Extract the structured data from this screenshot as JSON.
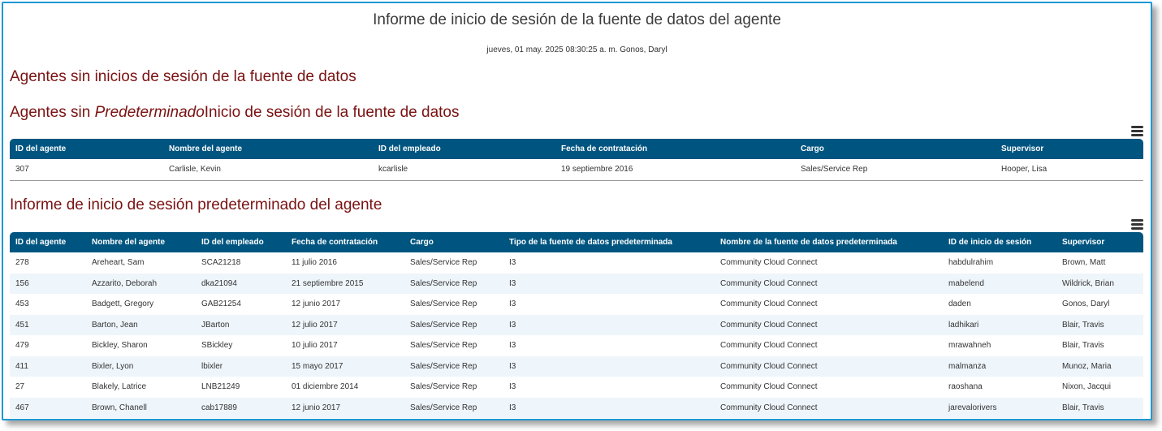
{
  "report": {
    "title": "Informe de inicio de sesión de la fuente de datos del agente",
    "meta": "jueves, 01 may. 2025 08:30:25 a. m. Gonos, Daryl"
  },
  "sections": {
    "no_logins": "Agentes sin inicios de sesión de la fuente de datos",
    "no_default_prefix": "Agentes sin ",
    "no_default_em": "Predeterminado",
    "no_default_suffix": "Inicio de sesión de la fuente de datos",
    "default_report": "Informe de inicio de sesión predeterminado del agente"
  },
  "icons": {
    "menu": "hamburger-menu-icon"
  },
  "colors": {
    "header_bg": "#005580",
    "heading": "#7a1212",
    "frame": "#1f97d4"
  },
  "table1": {
    "columns": [
      "ID del agente",
      "Nombre del agente",
      "ID del empleado",
      "Fecha de contratación",
      "Cargo",
      "Supervisor"
    ],
    "rows": [
      [
        "307",
        "Carlisle, Kevin",
        "kcarlisle",
        "19 septiembre 2016",
        "Sales/Service Rep",
        "Hooper, Lisa"
      ]
    ]
  },
  "table2": {
    "columns": [
      "ID del agente",
      "Nombre del agente",
      "ID del empleado",
      "Fecha de contratación",
      "Cargo",
      "Tipo de la fuente de datos predeterminada",
      "Nombre de la fuente de datos predeterminada",
      "ID de inicio de sesión",
      "Supervisor"
    ],
    "rows": [
      [
        "278",
        "Areheart, Sam",
        "SCA21218",
        "11 julio 2016",
        "Sales/Service Rep",
        "I3",
        "Community Cloud Connect",
        "habdulrahim",
        "Brown, Matt"
      ],
      [
        "156",
        "Azzarito, Deborah",
        "dka21094",
        "21 septiembre 2015",
        "Sales/Service Rep",
        "I3",
        "Community Cloud Connect",
        "mabelend",
        "Wildrick, Brian"
      ],
      [
        "453",
        "Badgett, Gregory",
        "GAB21254",
        "12 junio 2017",
        "Sales/Service Rep",
        "I3",
        "Community Cloud Connect",
        "daden",
        "Gonos, Daryl"
      ],
      [
        "451",
        "Barton, Jean",
        "JBarton",
        "12 julio 2017",
        "Sales/Service Rep",
        "I3",
        "Community Cloud Connect",
        "ladhikari",
        "Blair, Travis"
      ],
      [
        "479",
        "Bickley, Sharon",
        "SBickley",
        "10 julio 2017",
        "Sales/Service Rep",
        "I3",
        "Community Cloud Connect",
        "mrawahneh",
        "Blair, Travis"
      ],
      [
        "411",
        "Bixler, Lyon",
        "lbixler",
        "15 mayo 2017",
        "Sales/Service Rep",
        "I3",
        "Community Cloud Connect",
        "malmanza",
        "Munoz, Maria"
      ],
      [
        "27",
        "Blakely, Latrice",
        "LNB21249",
        "01 diciembre 2014",
        "Sales/Service Rep",
        "I3",
        "Community Cloud Connect",
        "raoshana",
        "Nixon, Jacqui"
      ],
      [
        "467",
        "Brown, Chanell",
        "cab17889",
        "12 junio 2017",
        "Sales/Service Rep",
        "I3",
        "Community Cloud Connect",
        "jarevalorivers",
        "Blair, Travis"
      ]
    ]
  }
}
